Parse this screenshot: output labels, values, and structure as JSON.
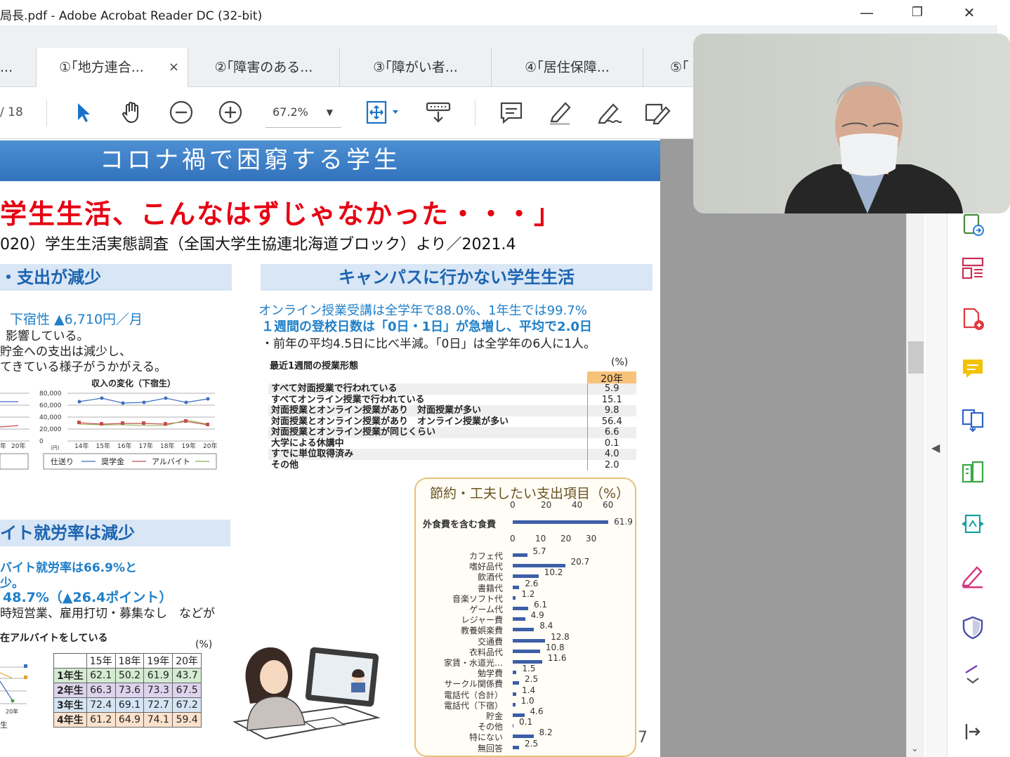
{
  "window": {
    "title": "局長.pdf - Adobe Acrobat Reader DC (32-bit)",
    "minimize": "—",
    "restore": "❐",
    "close": "✕"
  },
  "tabs": [
    {
      "label": "..."
    },
    {
      "label": "①｢地方連合...",
      "close": "×"
    },
    {
      "label": "②｢障害のある..."
    },
    {
      "label": "③｢障がい者..."
    },
    {
      "label": "④｢居住保障..."
    },
    {
      "label": "⑤｢"
    }
  ],
  "toolbar": {
    "page_total": "/ 18",
    "zoom": "67.2%"
  },
  "doc": {
    "banner": "コロナ禍で困窮する学生",
    "headline": "学生生活、こんなはずじゃなかった・・・」",
    "subline": "020）学生生活実態調査（全国大学生協連北海道ブロック）より／2021.4",
    "left1": {
      "title": "・支出が減少",
      "l1": "下宿性 ▲6,710円／月",
      "l2": "影響している。",
      "l3": "貯金への支出は減少し、",
      "l4": "てきている様子がうかがえる。"
    },
    "incomechart": {
      "title": "収入の変化（下宿生）",
      "yticks": [
        "80,000",
        "60,000",
        "40,000",
        "20,000",
        "0"
      ],
      "yunit": "(円)",
      "xticks": [
        "14年",
        "15年",
        "16年",
        "17年",
        "18年",
        "19年",
        "20年"
      ],
      "left_xticks": [
        "年",
        "20年"
      ],
      "legend": [
        "仕送り",
        "奨学金",
        "アルバイト"
      ]
    },
    "left2": {
      "title": "イト就労率は減少",
      "l1": "バイト就労率は66.9%と",
      "l2": "少。",
      "l3": "48.7%（▲26.4ポイント）",
      "l4": "時短営業、雇用打切・募集なし　などが",
      "l5": "在アルバイトをしている",
      "unit": "(%)"
    },
    "yeartable": {
      "headers": [
        "",
        "15年",
        "18年",
        "19年",
        "20年"
      ],
      "rows": [
        {
          "label": "1年生",
          "values": [
            "62.1",
            "50.2",
            "61.9",
            "43.7"
          ],
          "color": "#d4ebd1"
        },
        {
          "label": "2年生",
          "values": [
            "66.3",
            "73.6",
            "73.3",
            "67.5"
          ],
          "color": "#ddd3ec"
        },
        {
          "label": "3年生",
          "values": [
            "72.4",
            "69.1",
            "72.7",
            "67.2"
          ],
          "color": "#d5e5f4"
        },
        {
          "label": "4年生",
          "values": [
            "61.2",
            "64.9",
            "74.1",
            "59.4"
          ],
          "color": "#fbe2cc"
        }
      ],
      "leftfrag1": "20年",
      "leftfrag2": "生"
    },
    "right1": {
      "title": "キャンパスに行かない学生生活",
      "l1": "オンライン授業受講は全学年で88.0%、1年生では99.7%",
      "l2": "１週間の登校日数は「0日・1日」が急増し、平均で2.0日",
      "l3": "・前年の平均4.5日に比べ半減。「0日」は全学年の6人に1人。",
      "table_title": "最近1週間の授業形態",
      "unit": "(%)",
      "year": "20年"
    },
    "classtable": [
      {
        "label": "すべて対面授業で行われている",
        "value": "5.9"
      },
      {
        "label": "すべてオンライン授業で行われている",
        "value": "15.1"
      },
      {
        "label": "対面授業とオンライン授業があり　対面授業が多い",
        "value": "9.8"
      },
      {
        "label": "対面授業とオンライン授業があり　オンライン授業が多い",
        "value": "56.4"
      },
      {
        "label": "対面授業とオンライン授業が同じくらい",
        "value": "6.6"
      },
      {
        "label": "大学による休講中",
        "value": "0.1"
      },
      {
        "label": "すでに単位取得済み",
        "value": "4.0"
      },
      {
        "label": "その他",
        "value": "2.0"
      }
    ],
    "savings": {
      "title": "節約・工夫したい支出項目（%）",
      "axis1": [
        "0",
        "20",
        "40",
        "60"
      ],
      "axis2": [
        "0",
        "10",
        "20",
        "30"
      ],
      "top": {
        "label": "外食費を含む食費",
        "value": 61.9,
        "text": "61.9"
      },
      "items": [
        {
          "label": "カフェ代",
          "value": 5.7,
          "text": "5.7"
        },
        {
          "label": "嗜好品代",
          "value": 20.7,
          "text": "20.7"
        },
        {
          "label": "飲酒代",
          "value": 10.2,
          "text": "10.2"
        },
        {
          "label": "書籍代",
          "value": 2.6,
          "text": "2.6"
        },
        {
          "label": "音楽ソフト代",
          "value": 1.2,
          "text": "1.2"
        },
        {
          "label": "ゲーム代",
          "value": 6.1,
          "text": "6.1"
        },
        {
          "label": "レジャー費",
          "value": 4.9,
          "text": "4.9"
        },
        {
          "label": "教養娯楽費",
          "value": 8.4,
          "text": "8.4"
        },
        {
          "label": "交通費",
          "value": 12.8,
          "text": "12.8"
        },
        {
          "label": "衣料品代",
          "value": 10.8,
          "text": "10.8"
        },
        {
          "label": "家賃・水道光…",
          "value": 11.6,
          "text": "11.6"
        },
        {
          "label": "勉学費",
          "value": 1.5,
          "text": "1.5"
        },
        {
          "label": "サークル関係費",
          "value": 2.5,
          "text": "2.5"
        },
        {
          "label": "電話代（合計）",
          "value": 1.4,
          "text": "1.4"
        },
        {
          "label": "電話代（下宿）",
          "value": 1.0,
          "text": "1.0"
        },
        {
          "label": "貯金",
          "value": 4.6,
          "text": "4.6"
        },
        {
          "label": "その他",
          "value": 0.1,
          "text": "0.1"
        },
        {
          "label": "特にない",
          "value": 8.2,
          "text": "8.2"
        },
        {
          "label": "無回答",
          "value": 2.5,
          "text": "2.5"
        }
      ]
    },
    "page_number": "7"
  },
  "colors": {
    "banner": "#3d82c8",
    "headline": "#e60012",
    "accent": "#1f7fc8",
    "icon": "#1a73c8",
    "sidebar_red": "#e0393e",
    "sidebar_green": "#3aa843"
  }
}
